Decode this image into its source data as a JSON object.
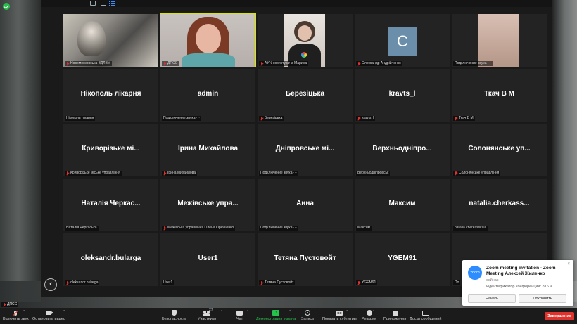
{
  "tiles": [
    {
      "name": "",
      "caption": "Новомосковська ВДЛВМ",
      "muted": true
    },
    {
      "name": "",
      "caption": "ДПСС",
      "muted": true
    },
    {
      "name": "",
      "caption": "АЎ½ користувача Марина",
      "muted": true
    },
    {
      "name": "",
      "caption": "Олександр Андрійченко",
      "muted": true,
      "avatar": "C"
    },
    {
      "name": "",
      "caption": "Подключение звука ···",
      "muted": false
    },
    {
      "name": "Нікополь лікарня",
      "caption": "Нікополь лікарня",
      "muted": false
    },
    {
      "name": "admin",
      "caption": "Подключение звука ···",
      "muted": false
    },
    {
      "name": "Березіцька",
      "caption": "Березіцька",
      "muted": true
    },
    {
      "name": "kravts_l",
      "caption": "kravts_l",
      "muted": true
    },
    {
      "name": "Ткач В М",
      "caption": "Ткач В М",
      "muted": true
    },
    {
      "name": "Криворізьке мі...",
      "caption": "Криворізьке міське управління",
      "muted": true
    },
    {
      "name": "Ірина Михайлова",
      "caption": "Ірина Михайлова",
      "muted": true
    },
    {
      "name": "Дніпровське мі...",
      "caption": "Подключение звука ···",
      "muted": false
    },
    {
      "name": "Верхньодніпро...",
      "caption": "Верхньодніпровськ",
      "muted": false
    },
    {
      "name": "Солонянське уп...",
      "caption": "Солонянське управління",
      "muted": true
    },
    {
      "name": "Наталія Черкас...",
      "caption": "Наталія Черкаська",
      "muted": false
    },
    {
      "name": "Межівське упра...",
      "caption": "Межівська управління Олена Кірюшенко",
      "muted": true
    },
    {
      "name": "Анна",
      "caption": "Подключение звука ···",
      "muted": false
    },
    {
      "name": "Максим",
      "caption": "Максим",
      "muted": false
    },
    {
      "name": "natalia.cherkass...",
      "caption": "natalia.cherkasskaia",
      "muted": false
    },
    {
      "name": "oleksandr.bularga",
      "caption": "oleksandr.bularga",
      "muted": true
    },
    {
      "name": "User1",
      "caption": "User1",
      "muted": false
    },
    {
      "name": "Тетяна Пустовойт",
      "caption": "Тетяна Пустовойт",
      "muted": true
    },
    {
      "name": "YGEM91",
      "caption": "YGEM91",
      "muted": true
    },
    {
      "name": "",
      "caption": "По",
      "muted": false
    }
  ],
  "self_view": {
    "caption": "ДПСС"
  },
  "toolbar": {
    "mic_label": "Включить звук",
    "video_label": "Остановить видео",
    "security_label": "Безопасность",
    "participants_label": "Участники",
    "participants_count": "27",
    "chat_label": "Чат",
    "share_label": "Демонстрация экрана",
    "record_label": "Запись",
    "subtitles_label": "Показать субтитры",
    "subtitles_icon_text": "CC",
    "reactions_label": "Реакции",
    "apps_label": "Приложения",
    "whiteboard_label": "Доски сообщений",
    "end_label": "Завершение"
  },
  "notification": {
    "logo_text": "zoom",
    "title": "Zoom meeting invitation - Zoom Meeting Алексей Жиленко",
    "time": "сейчас",
    "meta": "Идентификатор конференции: 816 9...",
    "accept_label": "Начать",
    "decline_label": "Отклонить",
    "close_glyph": "×"
  },
  "nav": {
    "back_glyph": "‹"
  },
  "colors": {
    "active_speaker": "#d9e600",
    "share_green": "#27c24c",
    "end_red": "#e0322c",
    "zoom_blue": "#2d8cff"
  }
}
